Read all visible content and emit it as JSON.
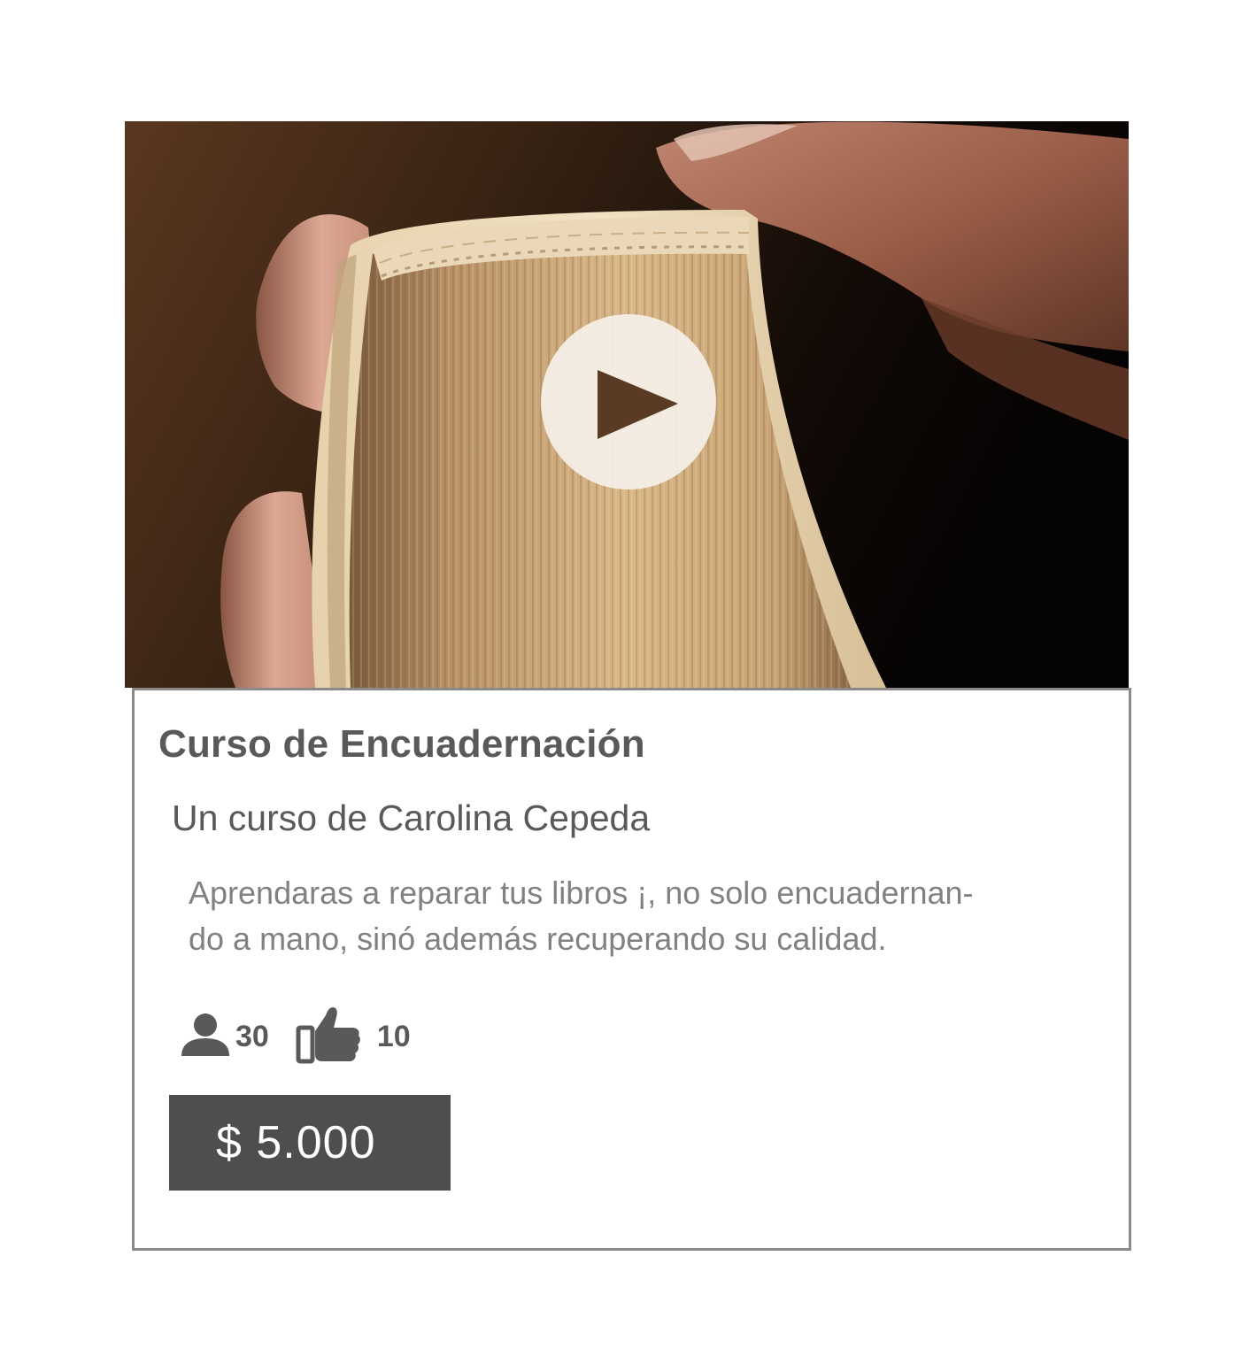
{
  "course": {
    "title": "Curso de Encuadernación",
    "author": "Un curso de Carolina Cepeda",
    "description_lines": [
      "Aprendaras a reparar tus libros ¡, no solo encuadernan-",
      "do a mano, sinó además recuperando su calidad."
    ],
    "stats": {
      "students": "30",
      "likes": "10"
    },
    "price": "$ 5.000"
  },
  "media": {
    "thumbnail": "book-spine-photo",
    "overlay_icon": "play-icon"
  },
  "icons": {
    "students": "person-icon",
    "likes": "thumbs-up-icon"
  },
  "colors": {
    "text_dark": "#58595b",
    "text_light": "#808184",
    "price_bg": "#4d4e4d",
    "border": "#8a8a8a",
    "play_overlay": "#f5f0e8"
  }
}
